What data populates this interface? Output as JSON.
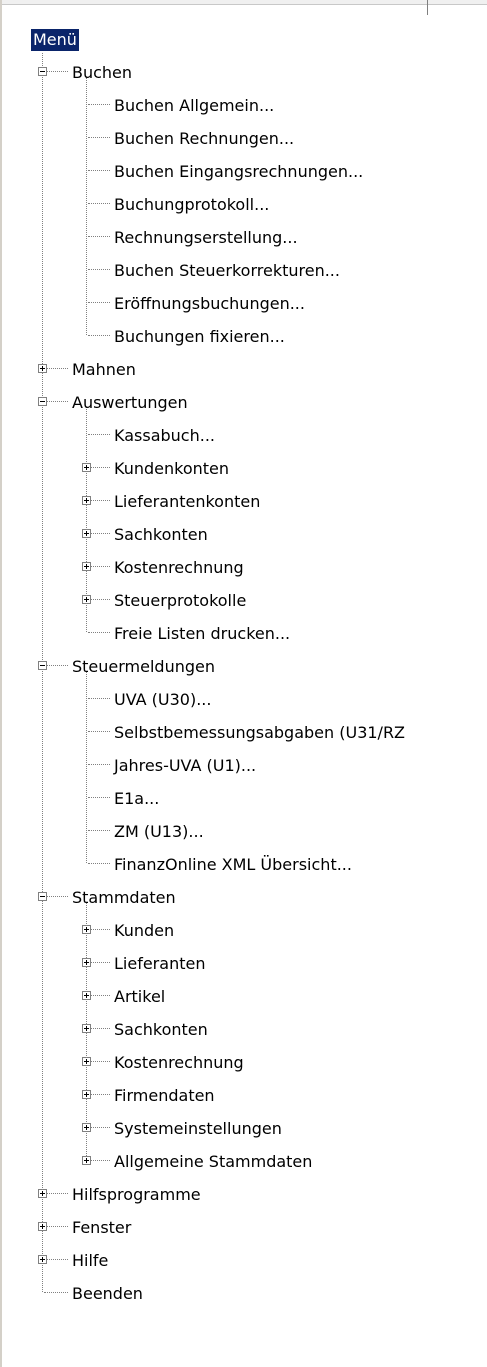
{
  "root": {
    "label": "Menü"
  },
  "nodes": [
    {
      "label": "Buchen",
      "level": 1,
      "kind": "expanded"
    },
    {
      "label": "Buchen Allgemein...",
      "level": 2,
      "kind": "leaf"
    },
    {
      "label": "Buchen Rechnungen...",
      "level": 2,
      "kind": "leaf"
    },
    {
      "label": "Buchen Eingangsrechnungen...",
      "level": 2,
      "kind": "leaf"
    },
    {
      "label": "Buchungprotokoll...",
      "level": 2,
      "kind": "leaf"
    },
    {
      "label": "Rechnungserstellung...",
      "level": 2,
      "kind": "leaf"
    },
    {
      "label": "Buchen Steuerkorrekturen...",
      "level": 2,
      "kind": "leaf"
    },
    {
      "label": "Eröffnungsbuchungen...",
      "level": 2,
      "kind": "leaf"
    },
    {
      "label": "Buchungen fixieren...",
      "level": 2,
      "kind": "leaf",
      "last": true
    },
    {
      "label": "Mahnen",
      "level": 1,
      "kind": "collapsed"
    },
    {
      "label": "Auswertungen",
      "level": 1,
      "kind": "expanded"
    },
    {
      "label": "Kassabuch...",
      "level": 2,
      "kind": "leaf"
    },
    {
      "label": "Kundenkonten",
      "level": 2,
      "kind": "collapsed"
    },
    {
      "label": "Lieferantenkonten",
      "level": 2,
      "kind": "collapsed"
    },
    {
      "label": "Sachkonten",
      "level": 2,
      "kind": "collapsed"
    },
    {
      "label": "Kostenrechnung",
      "level": 2,
      "kind": "collapsed"
    },
    {
      "label": "Steuerprotokolle",
      "level": 2,
      "kind": "collapsed"
    },
    {
      "label": "Freie Listen drucken...",
      "level": 2,
      "kind": "leaf",
      "last": true
    },
    {
      "label": "Steuermeldungen",
      "level": 1,
      "kind": "expanded"
    },
    {
      "label": "UVA (U30)...",
      "level": 2,
      "kind": "leaf"
    },
    {
      "label": "Selbstbemessungsabgaben (U31/RZ",
      "level": 2,
      "kind": "leaf"
    },
    {
      "label": "Jahres-UVA (U1)...",
      "level": 2,
      "kind": "leaf"
    },
    {
      "label": "E1a...",
      "level": 2,
      "kind": "leaf"
    },
    {
      "label": "ZM (U13)...",
      "level": 2,
      "kind": "leaf"
    },
    {
      "label": "FinanzOnline XML Übersicht...",
      "level": 2,
      "kind": "leaf",
      "last": true
    },
    {
      "label": "Stammdaten",
      "level": 1,
      "kind": "expanded"
    },
    {
      "label": "Kunden",
      "level": 2,
      "kind": "collapsed"
    },
    {
      "label": "Lieferanten",
      "level": 2,
      "kind": "collapsed"
    },
    {
      "label": "Artikel",
      "level": 2,
      "kind": "collapsed"
    },
    {
      "label": "Sachkonten",
      "level": 2,
      "kind": "collapsed"
    },
    {
      "label": "Kostenrechnung",
      "level": 2,
      "kind": "collapsed"
    },
    {
      "label": "Firmendaten",
      "level": 2,
      "kind": "collapsed"
    },
    {
      "label": "Systemeinstellungen",
      "level": 2,
      "kind": "collapsed"
    },
    {
      "label": "Allgemeine Stammdaten",
      "level": 2,
      "kind": "collapsed",
      "last": true
    },
    {
      "label": "Hilfsprogramme",
      "level": 1,
      "kind": "collapsed"
    },
    {
      "label": "Fenster",
      "level": 1,
      "kind": "collapsed"
    },
    {
      "label": "Hilfe",
      "level": 1,
      "kind": "collapsed"
    },
    {
      "label": "Beenden",
      "level": 1,
      "kind": "leaf",
      "last": true
    }
  ]
}
